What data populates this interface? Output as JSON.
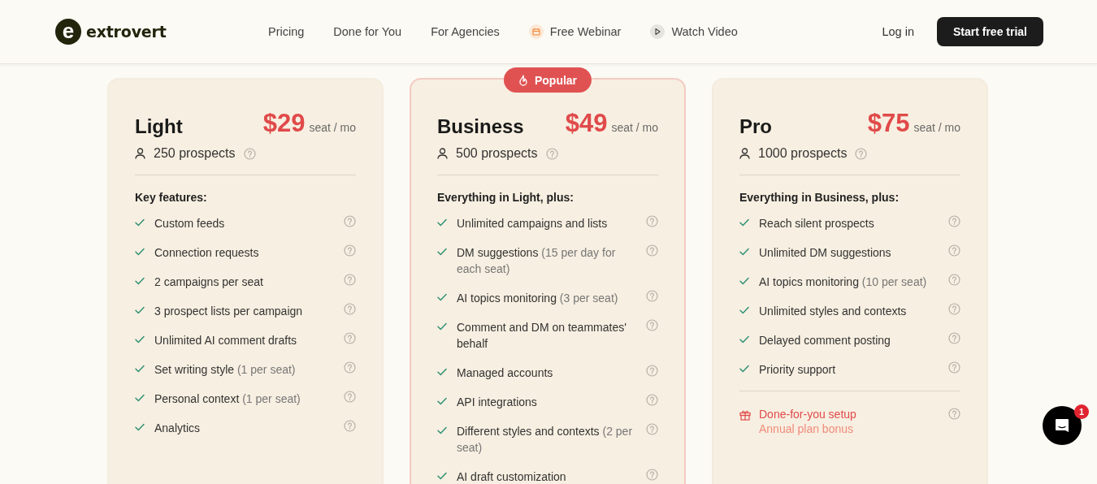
{
  "header": {
    "logo_mark": "e",
    "logo_text": "extrovert",
    "nav": [
      {
        "label": "Pricing",
        "kind": "link"
      },
      {
        "label": "Done for You",
        "kind": "link"
      },
      {
        "label": "For Agencies",
        "kind": "link"
      },
      {
        "label": "Free Webinar",
        "kind": "webinar"
      },
      {
        "label": "Watch Video",
        "kind": "video"
      }
    ],
    "login": "Log in",
    "cta": "Start free trial"
  },
  "plans": [
    {
      "name": "Light",
      "price": "$29",
      "unit": "seat / mo",
      "prospects": "250 prospects",
      "popular": false,
      "features_title": "Key features:",
      "features": [
        {
          "text": "Custom feeds"
        },
        {
          "text": "Connection requests"
        },
        {
          "text": "2 campaigns per seat"
        },
        {
          "text": "3 prospect lists per campaign"
        },
        {
          "text": "Unlimited AI comment drafts"
        },
        {
          "text": "Set writing style",
          "note": "(1 per seat)"
        },
        {
          "text": "Personal context",
          "note": "(1 per seat)"
        },
        {
          "text": "Analytics"
        }
      ]
    },
    {
      "name": "Business",
      "price": "$49",
      "unit": "seat / mo",
      "prospects": "500 prospects",
      "popular": true,
      "badge": "Popular",
      "features_title": "Everything in Light, plus:",
      "features": [
        {
          "text": "Unlimited campaigns and lists"
        },
        {
          "text": "DM suggestions",
          "note": "(15 per day for each seat)"
        },
        {
          "text": "AI topics monitoring",
          "note": "(3 per seat)"
        },
        {
          "text": "Comment and DM on teammates' behalf"
        },
        {
          "text": "Managed accounts"
        },
        {
          "text": "API integrations"
        },
        {
          "text": "Different styles and contexts",
          "note": "(2 per seat)"
        },
        {
          "text": "AI draft customization"
        }
      ]
    },
    {
      "name": "Pro",
      "price": "$75",
      "unit": "seat / mo",
      "prospects": "1000 prospects",
      "popular": false,
      "features_title": "Everything in Business, plus:",
      "features": [
        {
          "text": "Reach silent prospects"
        },
        {
          "text": "Unlimited DM suggestions"
        },
        {
          "text": "AI topics monitoring",
          "note": "(10 per seat)"
        },
        {
          "text": "Unlimited styles and contexts"
        },
        {
          "text": "Delayed comment posting"
        },
        {
          "text": "Priority support"
        }
      ],
      "bonus": {
        "title": "Done-for-you setup",
        "subtitle": "Annual plan bonus"
      }
    }
  ],
  "chat": {
    "badge": "1"
  }
}
